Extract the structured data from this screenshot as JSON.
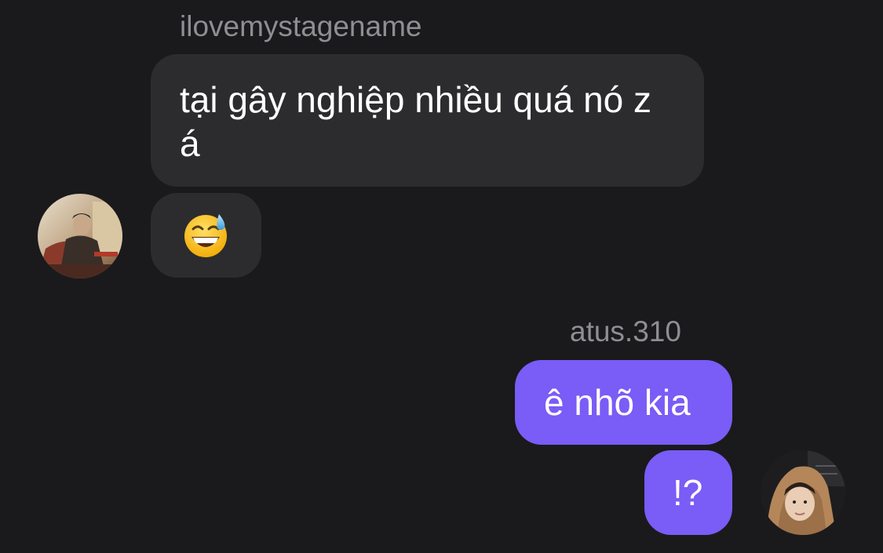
{
  "conversation": {
    "incoming": {
      "sender": "ilovemystagename",
      "messages": [
        {
          "text": "tại gây nghiệp nhiều quá nó z á"
        },
        {
          "text": "😅",
          "emoji_name": "grinning-face-with-sweat"
        }
      ],
      "avatar_icon": "user-avatar-photo"
    },
    "outgoing": {
      "sender": "atus.310",
      "messages": [
        {
          "text": "ê nhõ kia"
        },
        {
          "text": "!?"
        }
      ],
      "avatar_icon": "user-avatar-photo"
    }
  },
  "colors": {
    "background": "#1a1a1c",
    "incoming_bubble": "#2c2c2e",
    "outgoing_bubble": "#7a5cf6",
    "sender_name": "#8e8e93",
    "message_text": "#ffffff"
  }
}
